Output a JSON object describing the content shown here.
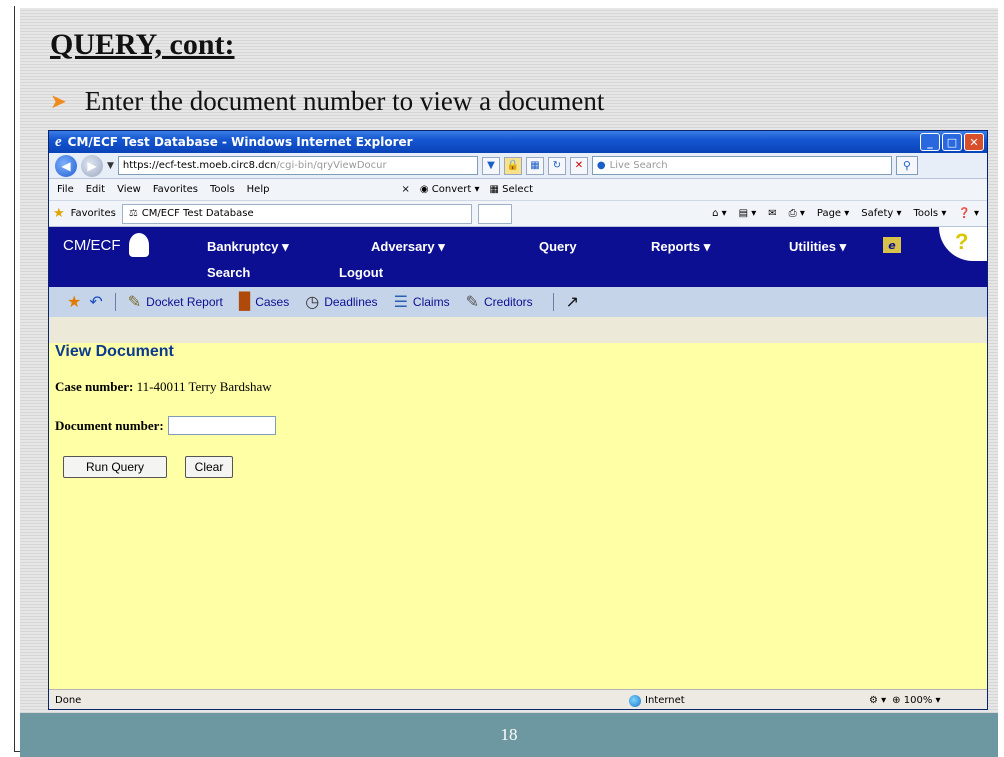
{
  "slide": {
    "title": "QUERY, cont:",
    "bullet": "Enter the document number to view a document",
    "page_number": "18"
  },
  "browser": {
    "window_title": "CM/ECF Test Database - Windows Internet Explorer",
    "url_host": "https://ecf-test.moeb.circ8.dcn",
    "url_path": "/cgi-bin/qryViewDocur",
    "search_placeholder": "Live Search",
    "menu": [
      "File",
      "Edit",
      "View",
      "Favorites",
      "Tools",
      "Help"
    ],
    "convert_label": "Convert",
    "select_label": "Select",
    "favorites_label": "Favorites",
    "tab_title": "CM/ECF Test Database",
    "page_menu": "Page",
    "safety_menu": "Safety",
    "tools_menu": "Tools",
    "status_text": "Done",
    "zone_text": "Internet",
    "zoom_text": "100%"
  },
  "ecf": {
    "logo_text": "CM/ECF",
    "nav": {
      "bankruptcy": "Bankruptcy",
      "adversary": "Adversary",
      "query": "Query",
      "reports": "Reports",
      "utilities": "Utilities",
      "search": "Search",
      "logout": "Logout"
    },
    "toolbar": {
      "docket_report": "Docket Report",
      "cases": "Cases",
      "deadlines": "Deadlines",
      "claims": "Claims",
      "creditors": "Creditors"
    },
    "page_title": "View Document",
    "case_label": "Case number:",
    "case_value": "11-40011 Terry Bardshaw",
    "document_label": "Document number:",
    "document_value": "",
    "run_query_label": "Run Query",
    "clear_label": "Clear"
  },
  "colors": {
    "header_bg": "#0c0f92",
    "content_bg": "#ffffa6",
    "footer_bar": "#6d97a1",
    "bullet_arrow": "#f08a1c"
  }
}
